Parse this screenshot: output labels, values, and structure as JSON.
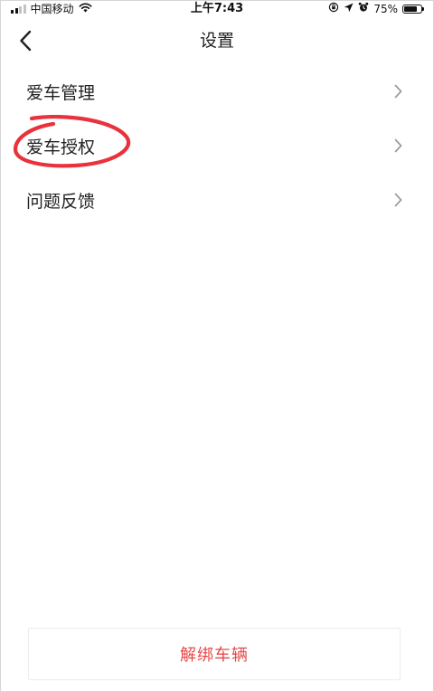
{
  "status_bar": {
    "carrier": "中国移动",
    "time": "上午7:43",
    "battery_text": "75%",
    "battery_level": 0.75,
    "signal_bars_total": 4,
    "signal_bars_active": 2,
    "icons": [
      "signal-icon",
      "wifi-icon",
      "orientation-lock-icon",
      "location-icon",
      "alarm-icon",
      "battery-icon"
    ]
  },
  "nav": {
    "title": "设置",
    "back_icon": "chevron-left-icon"
  },
  "menu": {
    "items": [
      {
        "label": "爱车管理",
        "icon": "chevron-right-icon"
      },
      {
        "label": "爱车授权",
        "icon": "chevron-right-icon"
      },
      {
        "label": "问题反馈",
        "icon": "chevron-right-icon"
      }
    ]
  },
  "annotation": {
    "target": "爱车授权",
    "shape": "hand-drawn-ellipse",
    "color": "#e8323c"
  },
  "footer": {
    "unbind_label": "解绑车辆"
  },
  "colors": {
    "text": "#222222",
    "chevron": "#9a9a9a",
    "danger": "#e54848",
    "border": "#ececec",
    "background": "#ffffff"
  }
}
